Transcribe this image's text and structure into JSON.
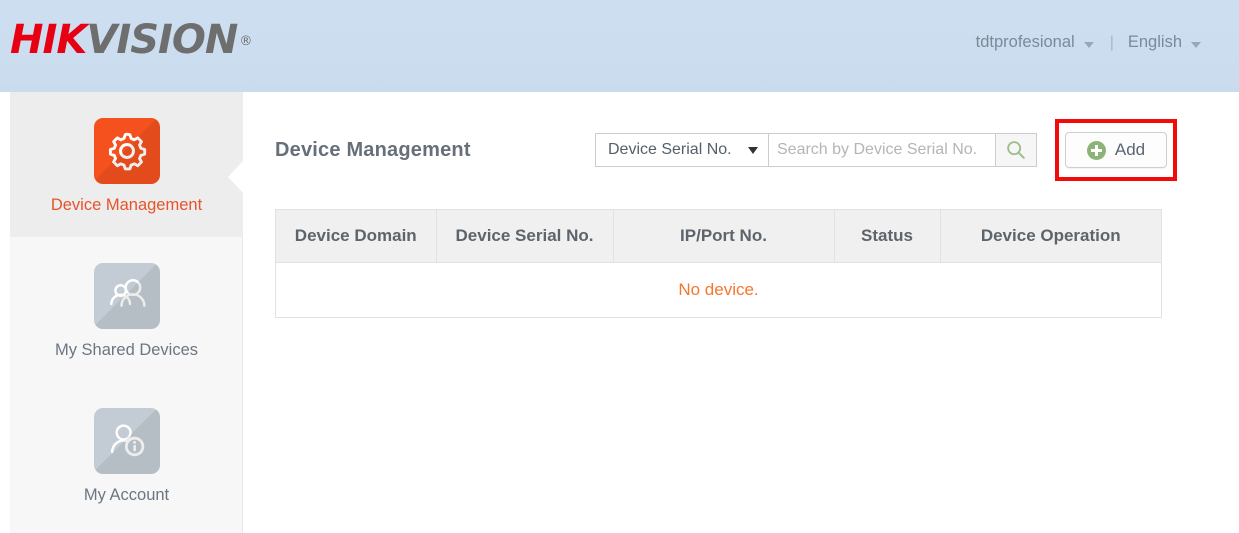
{
  "header": {
    "logo_hik": "HIK",
    "logo_vision": "VISION",
    "logo_reg": "®",
    "username": "tdtprofesional",
    "separator": "|",
    "language": "English"
  },
  "sidebar": {
    "items": [
      {
        "label": "Device Management",
        "icon": "gear-icon",
        "active": true
      },
      {
        "label": "My Shared Devices",
        "icon": "shared-users-icon",
        "active": false
      },
      {
        "label": "My Account",
        "icon": "user-info-icon",
        "active": false
      }
    ]
  },
  "main": {
    "title": "Device Management",
    "search": {
      "selected_option": "Device Serial No.",
      "options": [
        "Device Serial No."
      ],
      "placeholder": "Search by Device Serial No.",
      "value": "",
      "search_icon": "magnifier-icon"
    },
    "add_button": {
      "label": "Add",
      "icon": "plus-circle-icon"
    },
    "table": {
      "columns": [
        "Device Domain",
        "Device Serial No.",
        "IP/Port No.",
        "Status",
        "Device Operation"
      ],
      "empty_message": "No device.",
      "rows": []
    }
  },
  "colors": {
    "header_blue": "#cddef0",
    "brand_red": "#e60012",
    "accent_orange": "#f4511e",
    "empty_text_orange": "#f4772e",
    "annotation_red": "#f20b0b",
    "add_green": "#8eb377",
    "search_green": "#9dbf8e"
  }
}
